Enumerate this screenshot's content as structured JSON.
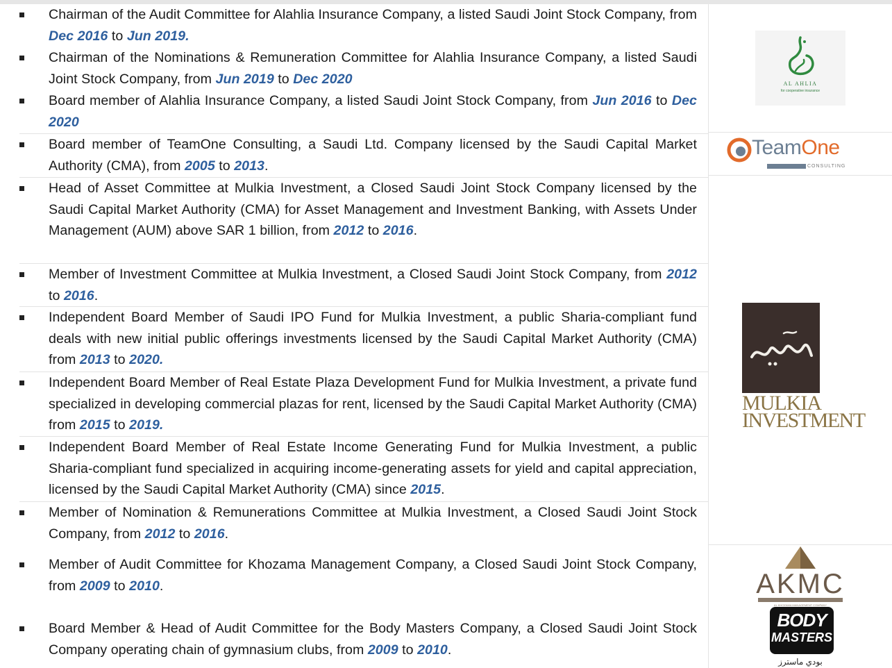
{
  "entries": [
    {
      "pre": "Chairman of the Audit Committee for Alahlia Insurance Company, a listed Saudi Joint Stock Company, from ",
      "d1": "Dec 2016",
      "mid": " to ",
      "d2": "Jun 2019.",
      "post": ""
    },
    {
      "pre": "Chairman of the Nominations & Remuneration Committee for Alahlia Insurance Company, a listed Saudi Joint Stock Company, from ",
      "d1": "Jun 2019",
      "mid": " to ",
      "d2": "Dec 2020",
      "post": ""
    },
    {
      "pre": "Board member of Alahlia Insurance Company, a listed Saudi Joint Stock Company, from ",
      "d1": "Jun 2016",
      "mid": " to ",
      "d2": "Dec 2020",
      "post": ""
    },
    {
      "pre": "Board member of TeamOne Consulting, a Saudi Ltd. Company licensed by the Saudi Capital Market Authority (CMA), from ",
      "d1": "2005",
      "mid": " to ",
      "d2": "2013",
      "post": "."
    },
    {
      "pre": "Head of Asset Committee at Mulkia Investment, a Closed Saudi Joint Stock Company licensed by the Saudi Capital Market Authority (CMA) for Asset Management and Investment Banking, with Assets Under Management (AUM) above SAR 1 billion, from ",
      "d1": "2012",
      "mid": " to ",
      "d2": "2016",
      "post": "."
    },
    {
      "pre": "Member of Investment Committee at Mulkia Investment, a Closed Saudi Joint Stock Company, from ",
      "d1": "2012",
      "mid": " to ",
      "d2": "2016",
      "post": "."
    },
    {
      "pre": "Independent Board Member of Saudi IPO Fund for Mulkia Investment, a public Sharia-compliant fund deals with new initial public offerings investments licensed by the Saudi Capital Market Authority (CMA) from ",
      "d1": "2013",
      "mid": " to ",
      "d2": "2020.",
      "post": ""
    },
    {
      "pre": "Independent Board Member of Real Estate Plaza Development Fund for Mulkia Investment, a private fund specialized in developing commercial plazas for rent, licensed by the Saudi Capital Market Authority (CMA) from ",
      "d1": "2015",
      "mid": " to ",
      "d2": "2019.",
      "post": ""
    },
    {
      "pre": "Independent Board Member of Real Estate Income Generating Fund for Mulkia Investment, a public Sharia-compliant fund specialized in acquiring income-generating assets for yield and capital appreciation, licensed by the Saudi Capital Market Authority (CMA) since ",
      "d1": "2015",
      "mid": "",
      "d2": "",
      "post": "."
    },
    {
      "pre": "Member of Nomination & Remunerations Committee at Mulkia Investment, a Closed Saudi Joint Stock Company, from ",
      "d1": "2012",
      "mid": " to ",
      "d2": "2016",
      "post": "."
    },
    {
      "pre": "Member of Audit Committee for Khozama Management Company, a Closed Saudi Joint Stock Company, from ",
      "d1": "2009",
      "mid": " to ",
      "d2": "2010",
      "post": "."
    },
    {
      "pre": "Board Member & Head of Audit Committee for the Body Masters Company, a Closed Saudi Joint Stock Company operating chain of gymnasium clubs, from ",
      "d1": "2009",
      "mid": " to ",
      "d2": "2010",
      "post": "."
    }
  ],
  "logos": {
    "alahlia": {
      "name": "AL AHLIA",
      "tagline": "for cooperative insurance"
    },
    "teamone": {
      "team": "Team",
      "one": "One",
      "sub": "CONSULTING"
    },
    "mulkia": {
      "line1": "MULKIA",
      "line2": "INVESTMENT"
    },
    "akmc": {
      "word": "AKMC",
      "sub": "AL KHOZAMA MANAGEMENT COMPANY"
    },
    "bodymasters": {
      "line1": "BODY",
      "line2": "MASTERS",
      "arabic": "بودي ماسترز"
    }
  },
  "colors": {
    "date_accent": "#2e5f9e",
    "mulkia_gold": "#8a7445",
    "mulkia_box": "#3a2e2b"
  }
}
